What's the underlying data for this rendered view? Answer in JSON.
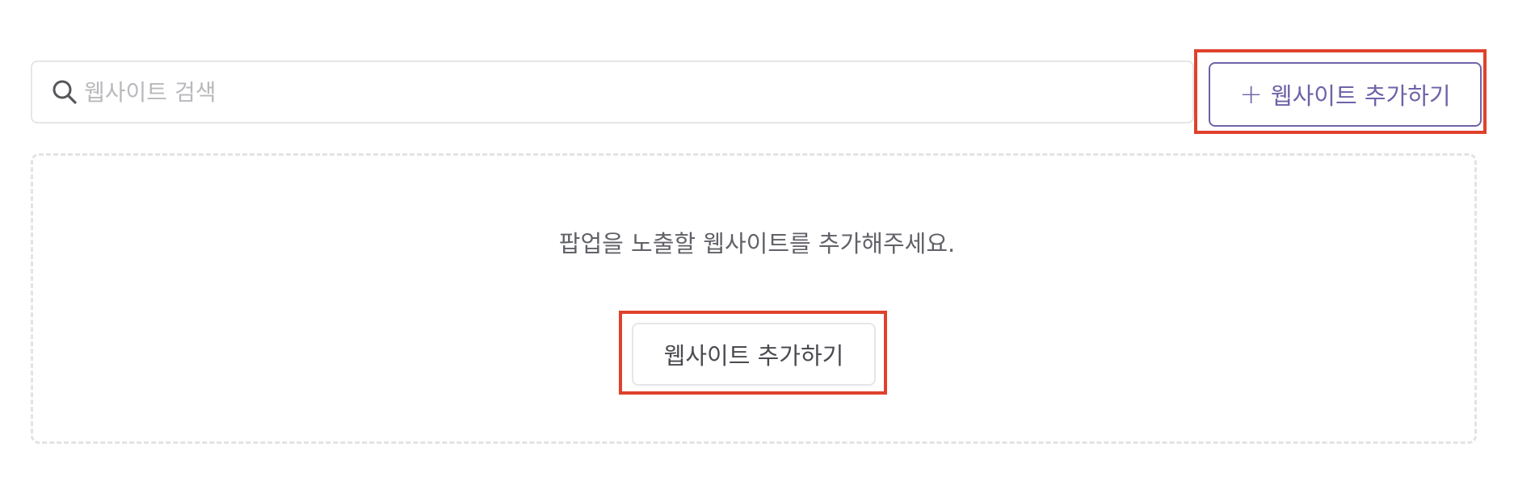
{
  "search": {
    "placeholder": "웹사이트 검색",
    "value": "",
    "icon": "search-icon"
  },
  "header_action": {
    "icon": "plus-icon",
    "plus_glyph": "+",
    "label": "웹사이트 추가하기",
    "accent_color": "#6e63a8"
  },
  "empty_state": {
    "message": "팝업을 노출할 웹사이트를 추가해주세요.",
    "button_label": "웹사이트 추가하기"
  },
  "highlight_color": "#e0412c"
}
